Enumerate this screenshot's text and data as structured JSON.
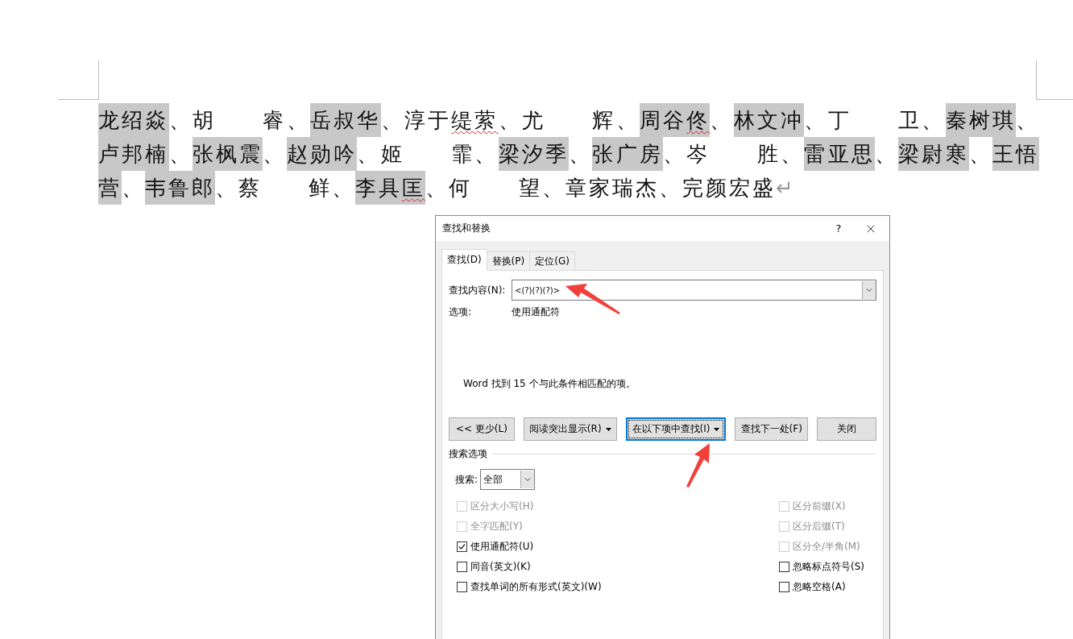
{
  "document": {
    "names": [
      {
        "parts": [
          {
            "text": "龙绍焱",
            "misspelled": false
          }
        ],
        "highlighted": true,
        "separator": "、"
      },
      {
        "parts": [
          {
            "text": "胡　　睿",
            "misspelled": false
          }
        ],
        "highlighted": false,
        "separator": "、"
      },
      {
        "parts": [
          {
            "text": "岳叔华",
            "misspelled": false
          }
        ],
        "highlighted": true,
        "separator": "、"
      },
      {
        "parts": [
          {
            "text": "淳于",
            "misspelled": false
          },
          {
            "text": "缇萦",
            "misspelled": true
          }
        ],
        "highlighted": false,
        "separator": "、"
      },
      {
        "parts": [
          {
            "text": "尤　　辉",
            "misspelled": false
          }
        ],
        "highlighted": false,
        "separator": "、"
      },
      {
        "parts": [
          {
            "text": "周谷",
            "misspelled": false
          },
          {
            "text": "佟",
            "misspelled": true
          }
        ],
        "highlighted": true,
        "separator": "、"
      },
      {
        "parts": [
          {
            "text": "林文冲",
            "misspelled": false
          }
        ],
        "highlighted": true,
        "separator": "、"
      },
      {
        "parts": [
          {
            "text": "丁　　卫",
            "misspelled": false
          }
        ],
        "highlighted": false,
        "separator": "、"
      },
      {
        "parts": [
          {
            "text": "秦树琪",
            "misspelled": false
          }
        ],
        "highlighted": true,
        "separator": "、"
      },
      {
        "parts": [
          {
            "text": "卢邦楠",
            "misspelled": false
          }
        ],
        "highlighted": true,
        "separator": "、"
      },
      {
        "parts": [
          {
            "text": "张枫震",
            "misspelled": false
          }
        ],
        "highlighted": true,
        "separator": "、"
      },
      {
        "parts": [
          {
            "text": "赵勋吟",
            "misspelled": false
          }
        ],
        "highlighted": true,
        "separator": "、"
      },
      {
        "parts": [
          {
            "text": "姬　　霏",
            "misspelled": false
          }
        ],
        "highlighted": false,
        "separator": "、"
      },
      {
        "parts": [
          {
            "text": "梁汐季",
            "misspelled": false
          }
        ],
        "highlighted": true,
        "separator": "、"
      },
      {
        "parts": [
          {
            "text": "张广房",
            "misspelled": false
          }
        ],
        "highlighted": true,
        "separator": "、"
      },
      {
        "parts": [
          {
            "text": "岑　　胜",
            "misspelled": false
          }
        ],
        "highlighted": false,
        "separator": "、"
      },
      {
        "parts": [
          {
            "text": "雷亚思",
            "misspelled": false
          }
        ],
        "highlighted": true,
        "separator": "、"
      },
      {
        "parts": [
          {
            "text": "梁尉寒",
            "misspelled": false
          }
        ],
        "highlighted": true,
        "separator": "、"
      },
      {
        "parts": [
          {
            "text": "王悟营",
            "misspelled": false
          }
        ],
        "highlighted": true,
        "separator": "、"
      },
      {
        "parts": [
          {
            "text": "韦鲁郎",
            "misspelled": false
          }
        ],
        "highlighted": true,
        "separator": "、"
      },
      {
        "parts": [
          {
            "text": "蔡　　鲜",
            "misspelled": false
          }
        ],
        "highlighted": false,
        "separator": "、"
      },
      {
        "parts": [
          {
            "text": "李具",
            "misspelled": false
          },
          {
            "text": "匡",
            "misspelled": true
          }
        ],
        "highlighted": true,
        "separator": "、"
      },
      {
        "parts": [
          {
            "text": "何　　望",
            "misspelled": false
          }
        ],
        "highlighted": false,
        "separator": "、"
      },
      {
        "parts": [
          {
            "text": "章家瑞杰",
            "misspelled": false
          }
        ],
        "highlighted": false,
        "separator": "、"
      },
      {
        "parts": [
          {
            "text": "完颜宏盛",
            "misspelled": false
          }
        ],
        "highlighted": false
      }
    ],
    "paragraph_mark": "↵"
  },
  "dialog": {
    "title": "查找和替换",
    "help": "?",
    "tabs": [
      {
        "label": "查找(D)",
        "selected": true
      },
      {
        "label": "替换(P)",
        "selected": false
      },
      {
        "label": "定位(G)",
        "selected": false
      }
    ],
    "find_field": {
      "label": "查找内容(N):",
      "value": "<(?)(?)(?)>"
    },
    "options": {
      "label": "选项:",
      "value": "使用通配符"
    },
    "message": "Word 找到 15 个与此条件相匹配的项。",
    "buttons": [
      {
        "label": "<< 更少(L)",
        "dropdown": false,
        "focused": false
      },
      {
        "label": "阅读突出显示(R)",
        "dropdown": true,
        "focused": false
      },
      {
        "label": "在以下项中查找(I)",
        "dropdown": true,
        "focused": true
      },
      {
        "label": "查找下一处(F)",
        "dropdown": false,
        "focused": false
      },
      {
        "label": "关闭",
        "dropdown": false,
        "focused": false
      }
    ],
    "search_options": {
      "title": "搜索选项",
      "direction_label": "搜索:",
      "direction_value": "全部",
      "left": [
        {
          "label": "区分大小写(H)",
          "checked": false,
          "disabled": true
        },
        {
          "label": "全字匹配(Y)",
          "checked": false,
          "disabled": true
        },
        {
          "label": "使用通配符(U)",
          "checked": true,
          "disabled": false
        },
        {
          "label": "同音(英文)(K)",
          "checked": false,
          "disabled": false
        },
        {
          "label": "查找单词的所有形式(英文)(W)",
          "checked": false,
          "disabled": false
        }
      ],
      "right": [
        {
          "label": "区分前缀(X)",
          "checked": false,
          "disabled": true
        },
        {
          "label": "区分后缀(T)",
          "checked": false,
          "disabled": true
        },
        {
          "label": "区分全/半角(M)",
          "checked": false,
          "disabled": true
        },
        {
          "label": "忽略标点符号(S)",
          "checked": false,
          "disabled": false
        },
        {
          "label": "忽略空格(A)",
          "checked": false,
          "disabled": false
        }
      ]
    }
  }
}
